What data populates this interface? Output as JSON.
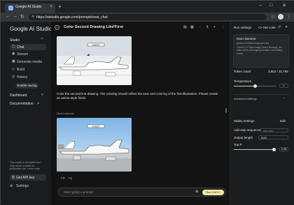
{
  "browser": {
    "tab_title": "Google AI Studio",
    "tab_close": "×",
    "new_tab": "+",
    "url": "https://aistudio.google.com/prompts/new_chat",
    "window_controls": [
      "–",
      "□",
      "✕"
    ]
  },
  "sidebar": {
    "logo": "Google AI Studio",
    "studio_label": "Studio",
    "items": [
      {
        "label": "Chat",
        "icon": "chat-icon",
        "glyph": "▢"
      },
      {
        "label": "Stream",
        "icon": "stream-icon",
        "glyph": "◉"
      },
      {
        "label": "Generate media",
        "icon": "media-icon",
        "glyph": "▣"
      },
      {
        "label": "Build",
        "icon": "build-icon",
        "glyph": "◇"
      },
      {
        "label": "History",
        "icon": "history-icon",
        "glyph": "◷"
      }
    ],
    "enable_saving": "Enable saving",
    "dashboard_label": "Dashboard",
    "documentation_label": "Documentation",
    "note": "This model is not stable and may not be suitable for production use. Learn more",
    "api_key": "Get API key",
    "settings": "Settings"
  },
  "chat": {
    "title": "Color Second Drawing Like First",
    "user_prompt": "Color the second line drawing. The coloring should reflect the tone and coloring of the first illustration. Please create an anime-style finish.",
    "model_label": "Model response",
    "input_placeholder": "Start typing a prompt",
    "run_label": "Run Ctrl+↵"
  },
  "run_settings": {
    "title": "Run settings",
    "get_code": "<> Get code",
    "model_name": "Nano Banana",
    "model_id": "gemini-2.5-flash-image-preview",
    "model_desc": "Gemini 2.5 Flash Image (Nano Banana), our state-of-the-art image generation and editing model.",
    "token_count_label": "Token count",
    "token_count_value": "3,802 / 32,768",
    "temperature_label": "Temperature",
    "temperature_value": "1",
    "temperature_fraction": 0.5,
    "advanced_label": "Advanced settings",
    "safety_label": "Safety settings",
    "safety_edit": "Edit",
    "stop_label": "Add stop sequence",
    "stop_placeholder": "Add stop...",
    "output_length_label": "Output length",
    "output_length_value": "8192",
    "top_p_label": "Top P",
    "top_p_value": "0.95",
    "top_p_fraction": 0.95
  },
  "colors": {
    "background": "#131314",
    "sidebar": "#1b1c1d",
    "run_button": "#f2e7a6",
    "accent": "#8ab4f8"
  }
}
